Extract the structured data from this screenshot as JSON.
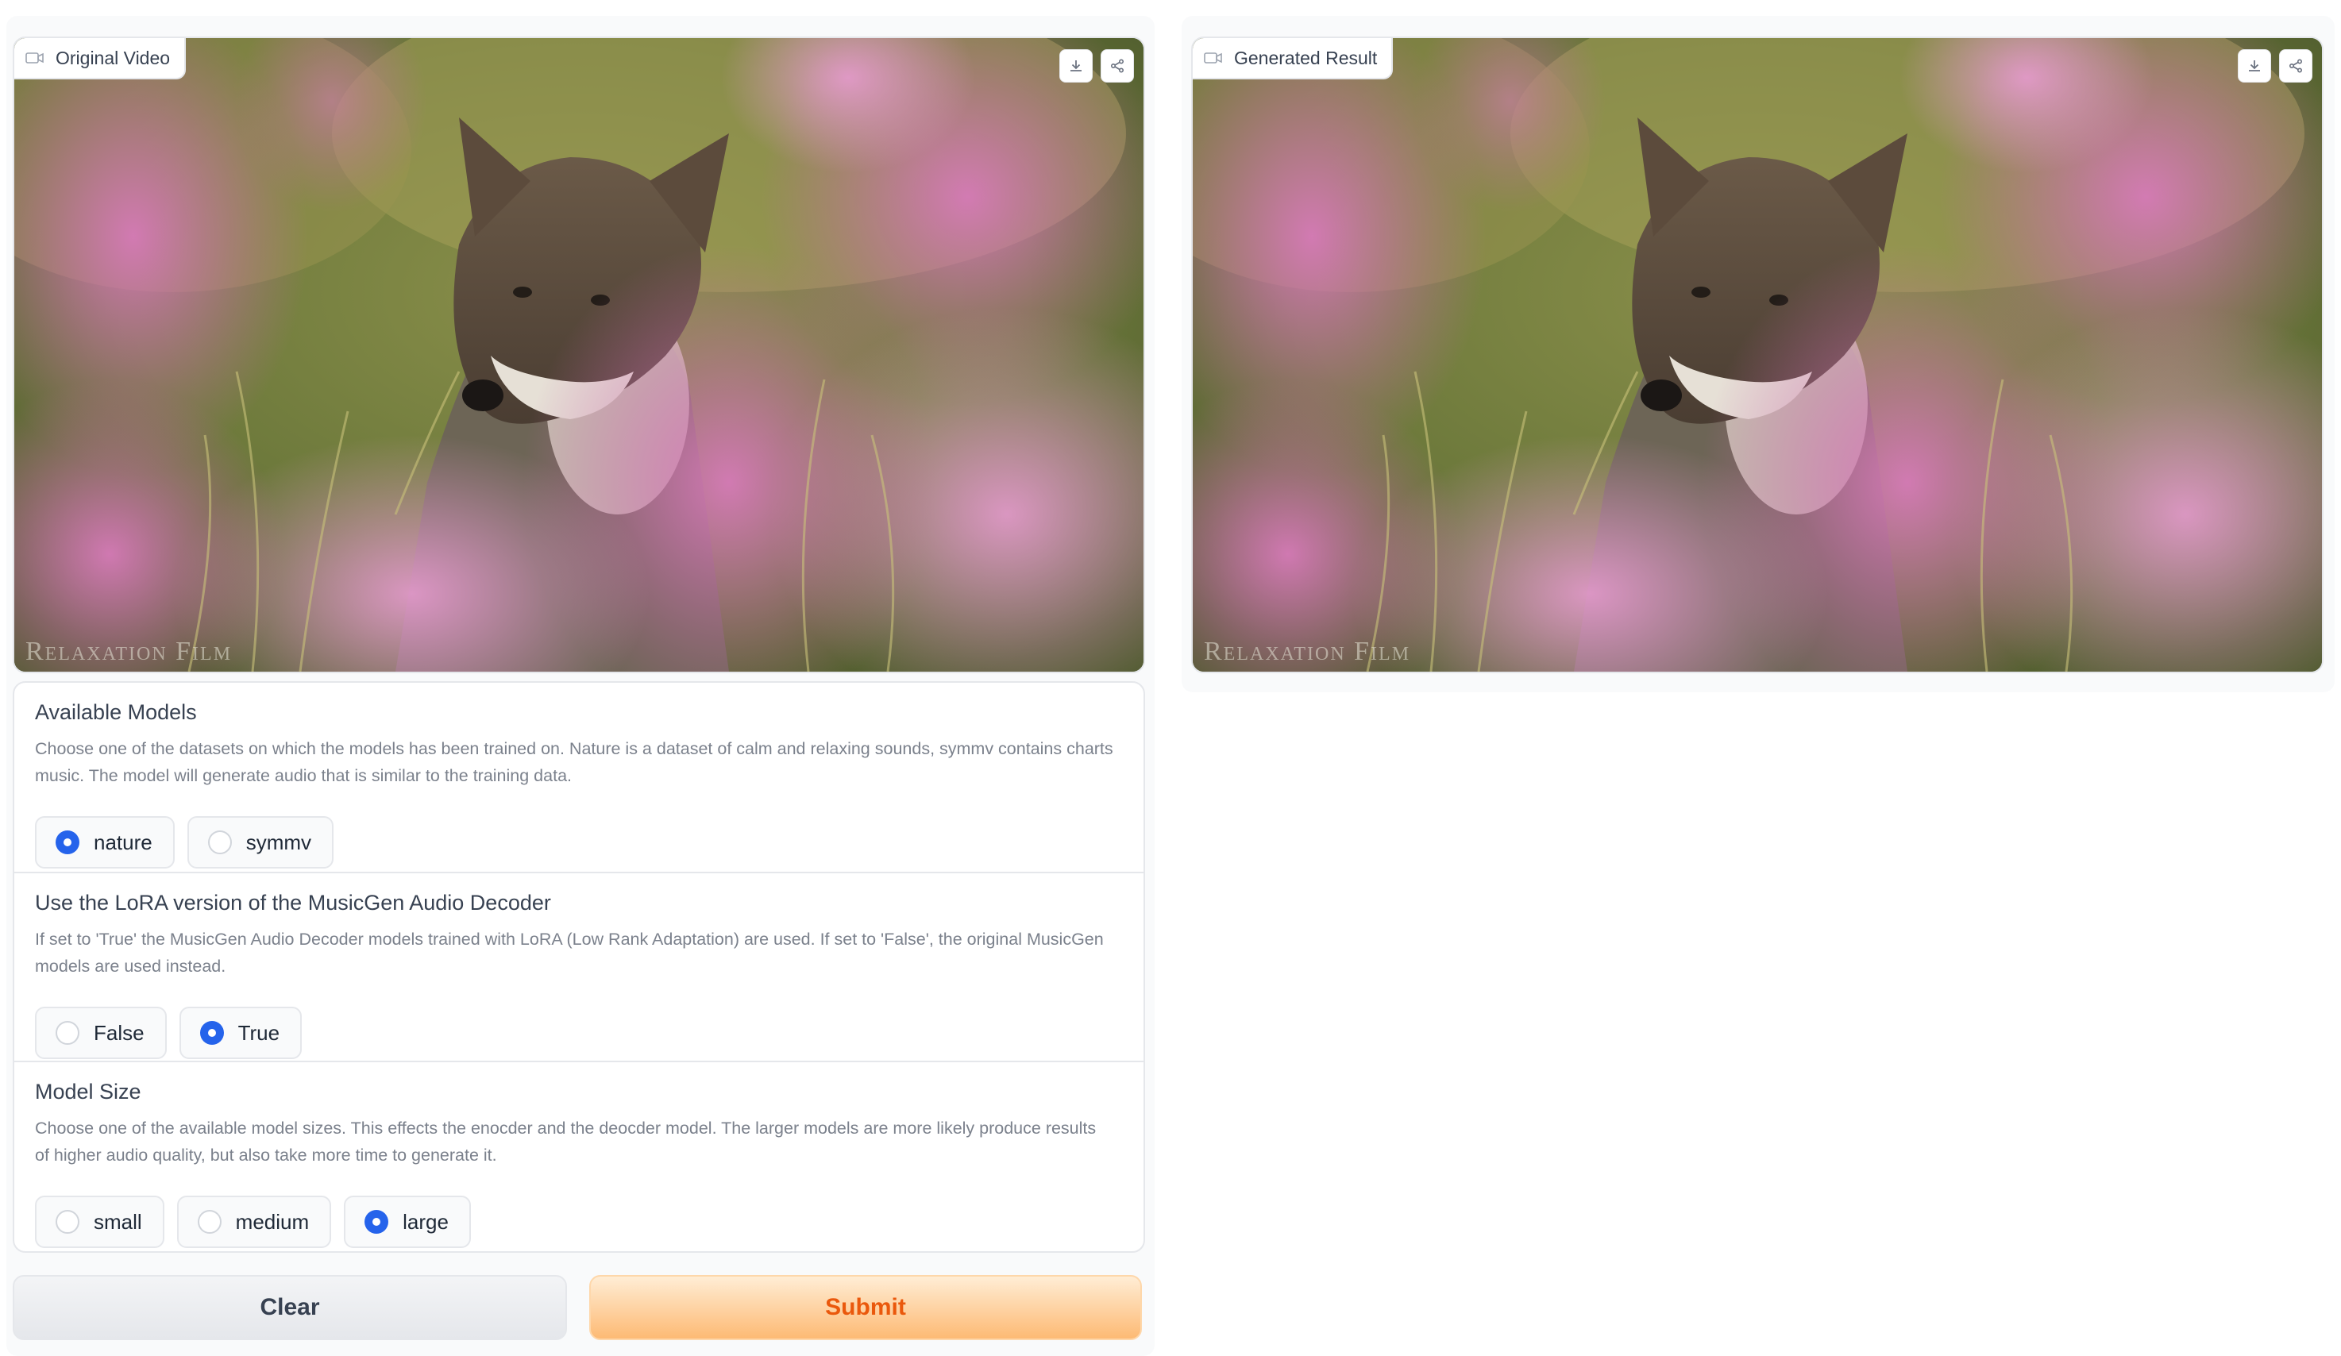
{
  "left_panel": {
    "video_label": "Original Video",
    "watermark": "Relaxation Film",
    "download_icon": "download-icon",
    "share_icon": "share-icon"
  },
  "right_panel": {
    "video_label": "Generated Result",
    "watermark": "Relaxation Film",
    "download_icon": "download-icon",
    "share_icon": "share-icon"
  },
  "settings": {
    "models": {
      "title": "Available Models",
      "info": "Choose one of the datasets on which the models has been trained on. Nature is a dataset of calm and relaxing sounds, symmv contains charts music. The model will generate audio that is similar to the training data.",
      "options": [
        "nature",
        "symmv"
      ],
      "selected": "nature"
    },
    "lora": {
      "title": "Use the LoRA version of the MusicGen Audio Decoder",
      "info": "If set to 'True' the MusicGen Audio Decoder models trained with LoRA (Low Rank Adaptation) are used. If set to 'False', the original MusicGen models are used instead.",
      "options": [
        "False",
        "True"
      ],
      "selected": "True"
    },
    "size": {
      "title": "Model Size",
      "info": "Choose one of the available model sizes. This effects the enocder and the deocder model. The larger models are more likely produce results of higher audio quality, but also take more time to generate it.",
      "options": [
        "small",
        "medium",
        "large"
      ],
      "selected": "large"
    }
  },
  "actions": {
    "clear_label": "Clear",
    "submit_label": "Submit"
  },
  "colors": {
    "accent": "#2563eb",
    "submit_text": "#ea580c",
    "submit_bg": "#fdba74"
  }
}
